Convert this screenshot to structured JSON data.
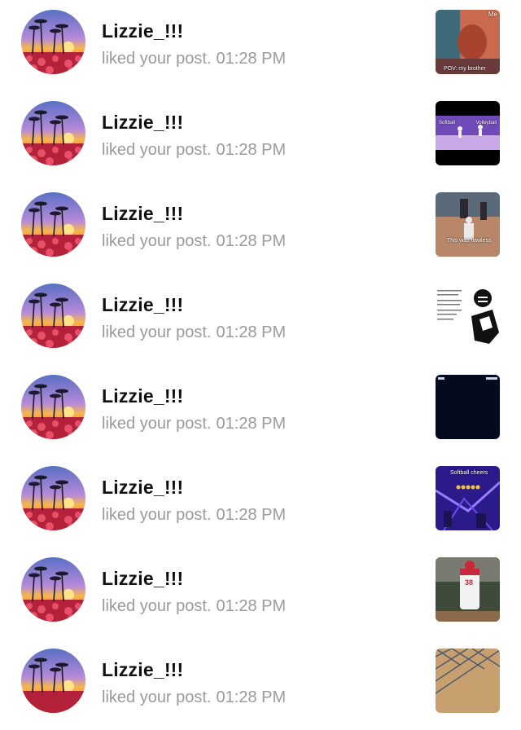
{
  "notifications": [
    {
      "username": "Lizzie_!!!",
      "action": "liked your post.",
      "time": "01:28 PM",
      "thumb_caption": "POV: my brother",
      "thumb_badge": "Me"
    },
    {
      "username": "Lizzie_!!!",
      "action": "liked your post.",
      "time": "01:28 PM",
      "thumb_left_label": "Softball",
      "thumb_right_label": "Volleyball"
    },
    {
      "username": "Lizzie_!!!",
      "action": "liked your post.",
      "time": "01:28 PM",
      "thumb_caption": "This was flawless"
    },
    {
      "username": "Lizzie_!!!",
      "action": "liked your post.",
      "time": "01:28 PM"
    },
    {
      "username": "Lizzie_!!!",
      "action": "liked your post.",
      "time": "01:28 PM"
    },
    {
      "username": "Lizzie_!!!",
      "action": "liked your post.",
      "time": "01:28 PM",
      "thumb_caption": "Softball cheers"
    },
    {
      "username": "Lizzie_!!!",
      "action": "liked your post.",
      "time": "01:28 PM",
      "thumb_caption": "38"
    },
    {
      "username": "Lizzie_!!!",
      "action": "liked your post.",
      "time": "01:28 PM"
    }
  ],
  "icons": {
    "avatar": "sunset-palm-trees-image",
    "thumbnail": "post-thumbnail-image"
  }
}
